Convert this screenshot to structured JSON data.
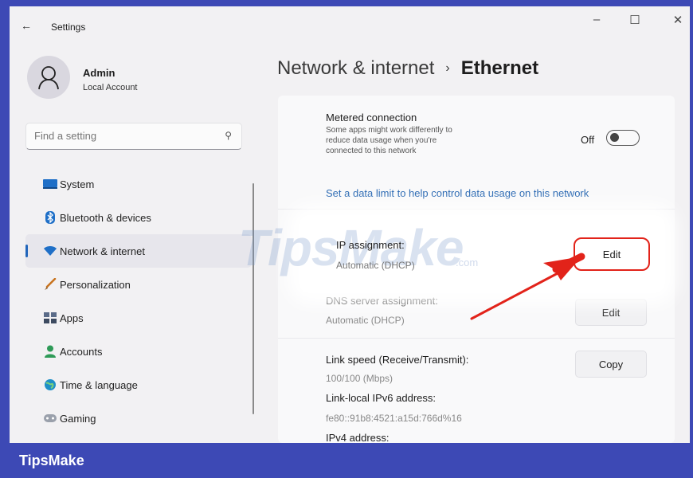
{
  "window": {
    "app_title": "Settings",
    "back_glyph": "←",
    "minimize_glyph": "–",
    "maximize_glyph": "☐",
    "close_glyph": "✕"
  },
  "user": {
    "name": "Admin",
    "account_type": "Local Account"
  },
  "search": {
    "placeholder": "Find a setting"
  },
  "sidebar": {
    "items": [
      {
        "label": "System",
        "icon": "system-icon"
      },
      {
        "label": "Bluetooth & devices",
        "icon": "bluetooth-icon"
      },
      {
        "label": "Network & internet",
        "icon": "wifi-icon",
        "active": true
      },
      {
        "label": "Personalization",
        "icon": "brush-icon"
      },
      {
        "label": "Apps",
        "icon": "apps-icon"
      },
      {
        "label": "Accounts",
        "icon": "accounts-icon"
      },
      {
        "label": "Time & language",
        "icon": "globe-icon"
      },
      {
        "label": "Gaming",
        "icon": "gamepad-icon"
      }
    ]
  },
  "breadcrumb": {
    "parent": "Network & internet",
    "separator": "›",
    "current": "Ethernet"
  },
  "settings": {
    "metered": {
      "title": "Metered connection",
      "description_lines": [
        "Some apps might work differently to",
        "reduce data usage when you're",
        "connected to this network"
      ],
      "toggle_state": "Off",
      "toggle_on": false
    },
    "data_limit_link": "Set a data limit to help control data usage on this network",
    "ip_assignment": {
      "title": "IP assignment:",
      "value": "Automatic (DHCP)",
      "button": "Edit"
    },
    "dns_assignment": {
      "title": "DNS server assignment:",
      "value": "Automatic (DHCP)",
      "button": "Edit"
    },
    "link_speed": {
      "title": "Link speed (Receive/Transmit):",
      "value": "100/100 (Mbps)",
      "button": "Copy"
    },
    "ipv6": {
      "title": "Link-local IPv6 address:",
      "value": "fe80::91b8:4521:a15d:766d%16"
    },
    "ipv4": {
      "title": "IPv4 address:"
    }
  },
  "watermark": {
    "text": "TipsMake",
    "suffix": ".com"
  },
  "footer": {
    "brand": "TipsMake"
  },
  "colors": {
    "frame": "#3d49b5",
    "accent": "#2266bb",
    "link": "#1c5fae",
    "highlight_border": "#e2231a",
    "arrow": "#e2231a"
  }
}
